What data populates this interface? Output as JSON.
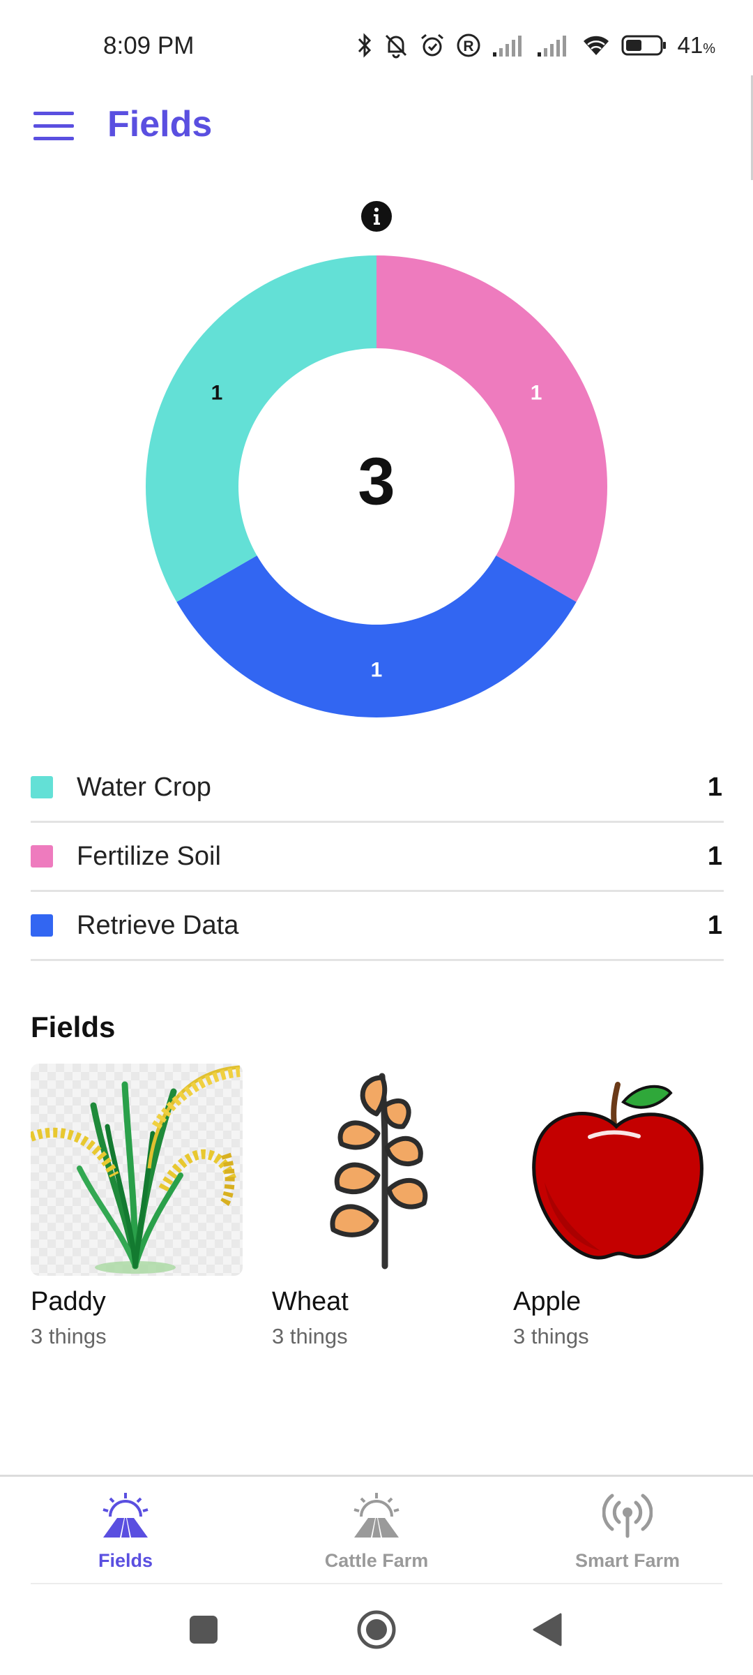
{
  "status_bar": {
    "time": "8:09 PM",
    "battery_percent": "41",
    "battery_unit": "%",
    "icons": [
      "bluetooth-icon",
      "bell-off-icon",
      "alarm-icon",
      "registered-icon",
      "signal-icon",
      "signal-icon",
      "wifi-icon",
      "battery-icon"
    ]
  },
  "header": {
    "title": "Fields",
    "menu_icon": "hamburger-menu-icon"
  },
  "chart_data": {
    "type": "pie",
    "center_total": "3",
    "segments": [
      {
        "label": "Water Crop",
        "value": 1,
        "color": "#63e0d6"
      },
      {
        "label": "Fertilize Soil",
        "value": 1,
        "color": "#ee7bbe"
      },
      {
        "label": "Retrieve Data",
        "value": 1,
        "color": "#3266f2"
      }
    ],
    "colors": {
      "label_dark": "#111111",
      "label_light": "#ffffff"
    }
  },
  "legend": [
    {
      "label": "Water Crop",
      "value": "1",
      "color": "#63e0d6"
    },
    {
      "label": "Fertilize Soil",
      "value": "1",
      "color": "#ee7bbe"
    },
    {
      "label": "Retrieve Data",
      "value": "1",
      "color": "#3266f2"
    }
  ],
  "fields_section": {
    "title": "Fields",
    "items": [
      {
        "name": "Paddy",
        "count": "3 things",
        "icon": "paddy-plant-icon"
      },
      {
        "name": "Wheat",
        "count": "3 things",
        "icon": "wheat-icon"
      },
      {
        "name": "Apple",
        "count": "3 things",
        "icon": "apple-icon"
      }
    ]
  },
  "bottom_nav": {
    "items": [
      {
        "label": "Fields",
        "icon": "fields-icon",
        "active": true
      },
      {
        "label": "Cattle Farm",
        "icon": "cattle-farm-icon",
        "active": false
      },
      {
        "label": "Smart Farm",
        "icon": "smart-farm-icon",
        "active": false
      }
    ],
    "active_color": "#5a4fe0",
    "inactive_color": "#9a9a9a"
  }
}
